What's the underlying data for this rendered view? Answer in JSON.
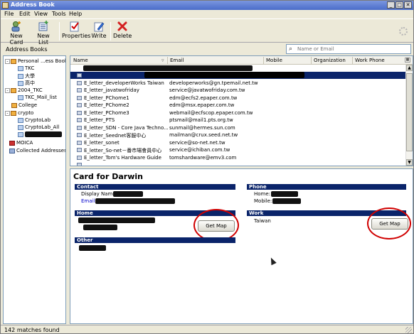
{
  "window": {
    "title": "Address Book"
  },
  "menu": [
    "File",
    "Edit",
    "View",
    "Tools",
    "Help"
  ],
  "toolbar": {
    "new_card": "New Card",
    "new_list": "New List",
    "properties": "Properties",
    "write": "Write",
    "delete": "Delete"
  },
  "address_books_label": "Address Books",
  "search": {
    "placeholder": "Name or Email"
  },
  "tree": [
    {
      "label": "Personal ...ess Book",
      "icon": "book-icon",
      "expander": "-"
    },
    {
      "label": "TKC",
      "icon": "list-icon"
    },
    {
      "label": "大學",
      "icon": "list-icon"
    },
    {
      "label": "高中",
      "icon": "list-icon"
    },
    {
      "label": "2004_TKC",
      "icon": "book-icon",
      "expander": "-"
    },
    {
      "label": "TKC_Mail_list",
      "icon": "list-icon"
    },
    {
      "label": "College",
      "icon": "book-icon"
    },
    {
      "label": "crypto",
      "icon": "book-icon",
      "expander": "-"
    },
    {
      "label": "CryptoLab",
      "icon": "list-icon"
    },
    {
      "label": "CryptoLab_All",
      "icon": "list-icon"
    },
    {
      "label": "",
      "icon": "list-icon"
    },
    {
      "label": "MOICA",
      "icon": "ldap-icon"
    },
    {
      "label": "Collected Addresses",
      "icon": "book-icon"
    }
  ],
  "columns": {
    "name": "Name",
    "email": "Email",
    "mobile": "Mobile",
    "organization": "Organization",
    "work_phone": "Work Phone"
  },
  "rows": [
    {
      "name": "",
      "email": ""
    },
    {
      "name": "",
      "email": ""
    },
    {
      "name": "E_letter_developerWorks Taiwan",
      "email": "developerworks@gn.tpemail.net.tw"
    },
    {
      "name": "E_letter_javatwofriday",
      "email": "service@javatwofriday.com.tw"
    },
    {
      "name": "E_letter_PChome1",
      "email": "edm@ecfs2.epaper.com.tw"
    },
    {
      "name": "E_letter_PChome2",
      "email": "edm@msx.epaper.com.tw"
    },
    {
      "name": "E_letter_PChome3",
      "email": "webmail@ecfscop.epaper.com.tw"
    },
    {
      "name": "E_letter_PTS",
      "email": "ptsmail@mail1.pts.org.tw"
    },
    {
      "name": "E_letter_SDN - Core Java Techno...",
      "email": "sunmail@hermes.sun.com"
    },
    {
      "name": "E_letter_Seednet客服中心",
      "email": "mailman@crux.seed.net.tw"
    },
    {
      "name": "E_letter_sonet",
      "email": "service@so-net.net.tw"
    },
    {
      "name": "E_letter_So-net－番市場會員中心",
      "email": "service@ichiban.com.tw"
    },
    {
      "name": "E_letter_Tom's Hardware Guide",
      "email": "tomshardware@emv3.com"
    }
  ],
  "card": {
    "title": "Card for Darwin",
    "contact_header": "Contact",
    "display_name_label": "Display Name:",
    "email_label": "Email:",
    "phone_header": "Phone",
    "home_phone_label": "Home:",
    "mobile_label": "Mobile:",
    "home_header": "Home",
    "work_header": "Work",
    "work_country": "Taiwan",
    "other_header": "Other",
    "get_map_home": "Get Map",
    "get_map_work": "Get Map"
  },
  "status": {
    "text": "142 matches found"
  },
  "colors": {
    "header_blue": "#0a246a",
    "annotation_red": "#d00000",
    "link_blue": "#0000cc"
  }
}
